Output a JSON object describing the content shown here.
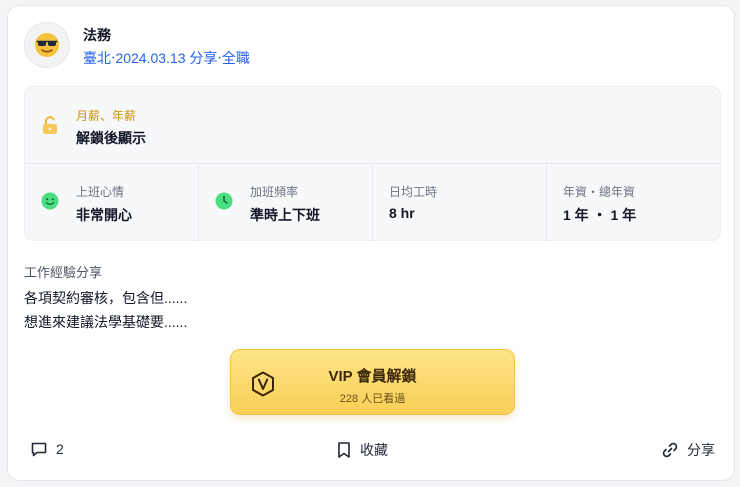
{
  "post": {
    "title": "法務",
    "meta": "臺北‧2024.03.13 分享‧全職",
    "avatar_icon": "sunglasses-face-icon"
  },
  "salary": {
    "label": "月薪、年薪",
    "value": "解鎖後顯示",
    "icon": "unlock-icon"
  },
  "stats": [
    {
      "label": "上班心情",
      "value": "非常開心",
      "icon": "smile-icon"
    },
    {
      "label": "加班頻率",
      "value": "準時上下班",
      "icon": "clock-icon"
    },
    {
      "label": "日均工時",
      "value": "8 hr"
    },
    {
      "label": "年資・總年資",
      "value": "1 年 ・ 1 年"
    }
  ],
  "experience": {
    "title": "工作經驗分享",
    "lines": [
      "各項契約審核，包含但......",
      "想進來建議法學基礎要......"
    ]
  },
  "vip": {
    "title": "VIP 會員解鎖",
    "subtitle": "228 人已看過",
    "icon": "vip-badge-icon"
  },
  "footer": {
    "comments_count": "2",
    "save_label": "收藏",
    "share_label": "分享"
  },
  "colors": {
    "accent_blue": "#2563eb",
    "salary_gold": "#c9930b",
    "stat_green": "#4ade80",
    "vip_gold": "#f9cf56"
  }
}
